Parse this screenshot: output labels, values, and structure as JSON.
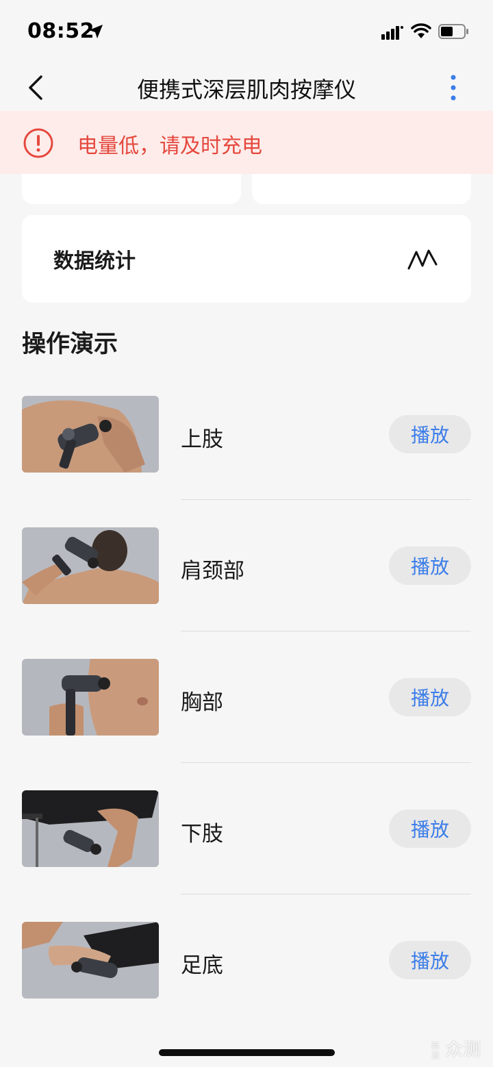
{
  "status_bar": {
    "time": "08:52"
  },
  "nav": {
    "title": "便携式深层肌肉按摩仪"
  },
  "alert": {
    "text": "电量低，请及时充电",
    "color": "#e5483e"
  },
  "stats": {
    "label": "数据统计"
  },
  "section": {
    "title": "操作演示"
  },
  "demos": [
    {
      "label": "上肢",
      "button": "播放"
    },
    {
      "label": "肩颈部",
      "button": "播放"
    },
    {
      "label": "胸部",
      "button": "播放"
    },
    {
      "label": "下肢",
      "button": "播放"
    },
    {
      "label": "足底",
      "button": "播放"
    }
  ],
  "watermark": {
    "small": "新浪",
    "large": "众测"
  },
  "colors": {
    "accent": "#3b7de9",
    "background": "#f6f6f6",
    "alert_bg": "#fdecea"
  }
}
